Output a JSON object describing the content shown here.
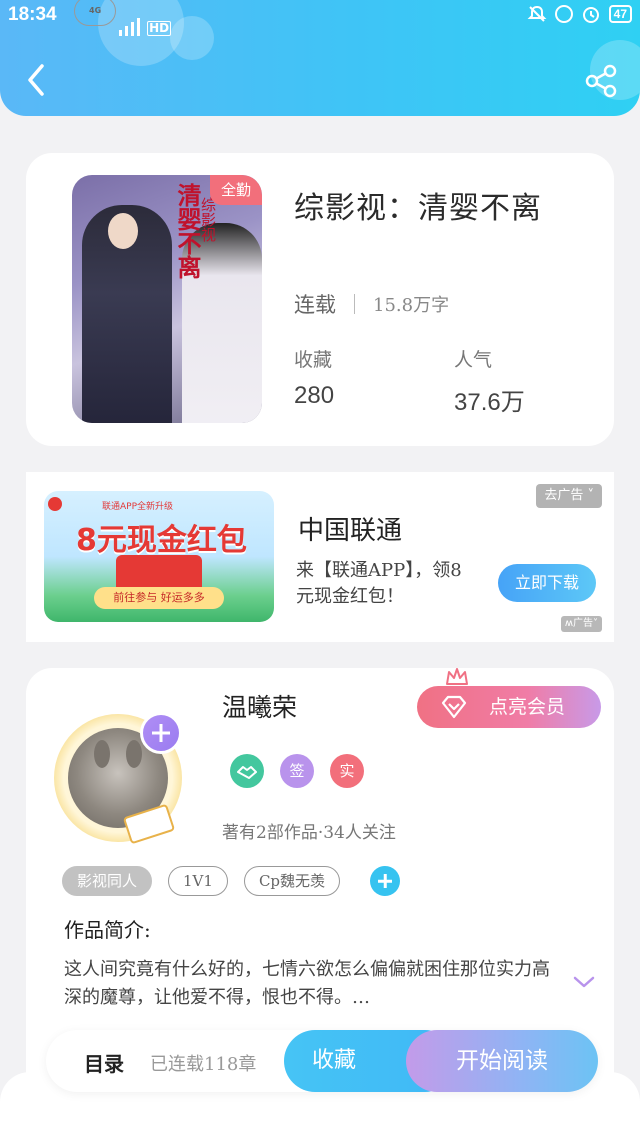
{
  "status_bar": {
    "time": "18:34",
    "network": "4G",
    "hd": "HD",
    "battery": "47"
  },
  "nav": {
    "back_icon": "chevron-left-icon",
    "share_icon": "share-icon"
  },
  "book": {
    "title": "综影视：清婴不离",
    "cover_ribbon": "全勤",
    "cover_title": "清婴不离",
    "cover_subtitle": "综影视",
    "status": "连载",
    "word_count": "15.8万字",
    "favorites_label": "收藏",
    "favorites_value": "280",
    "popularity_label": "人气",
    "popularity_value": "37.6万"
  },
  "ad": {
    "image_top_text": "联通APP全新升级",
    "image_headline": "8元现金红包",
    "image_button": "前往参与 好运多多",
    "advertiser": "中国联通",
    "text": "来【联通APP】，领8元现金红包！",
    "close_label": "去广告",
    "download_label": "立即下载",
    "ad_mark": "广告"
  },
  "author": {
    "name": "温曦荣",
    "vip_button": "点亮会员",
    "badges": [
      "签",
      "实"
    ],
    "stats": "著有2部作品·34人关注"
  },
  "tags": [
    "影视同人",
    "1V1",
    "Cp魏无羡"
  ],
  "intro": {
    "title": "作品简介:",
    "text": "这人间究竟有什么好的，七情六欲怎么偏偏就困住那位实力高深的魔尊，让他爱不得，恨也不得。…"
  },
  "actions": {
    "toc": "目录",
    "chapters": "已连载118章",
    "favorite": "收藏",
    "read": "开始阅读"
  }
}
